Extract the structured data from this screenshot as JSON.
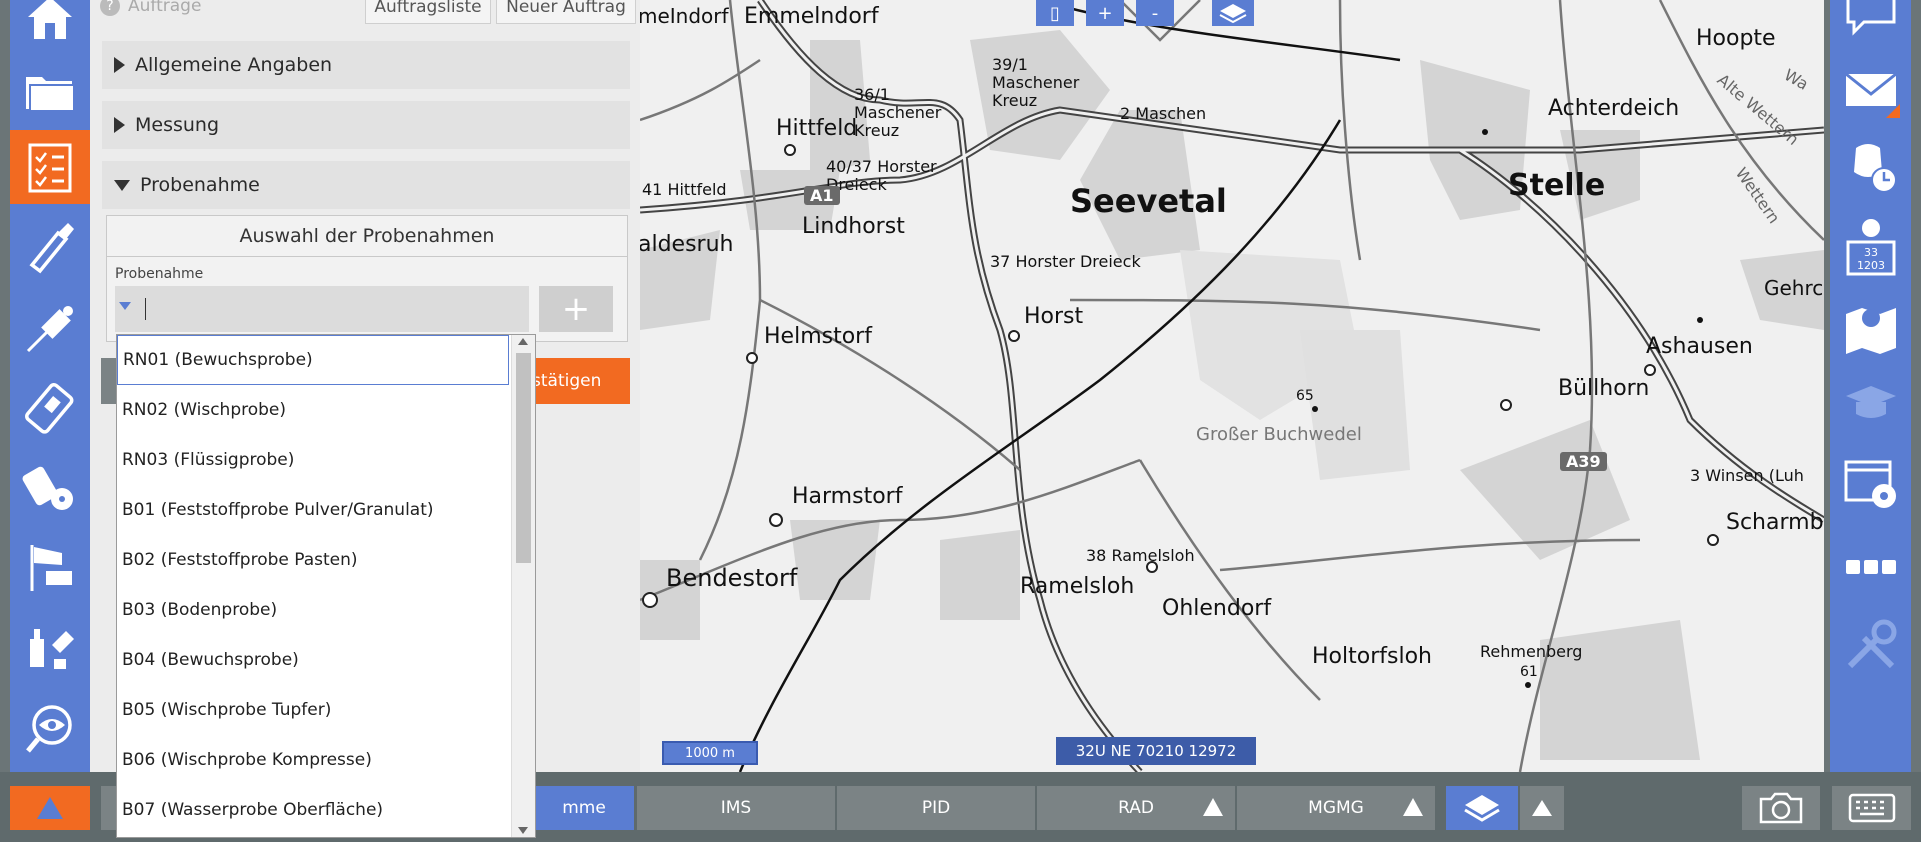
{
  "panel": {
    "top_title": "Aufträge",
    "btn_list": "Auftragsliste",
    "btn_new": "Neuer Auftrag",
    "sections": [
      {
        "label": "Allgemeine Angaben",
        "expanded": false
      },
      {
        "label": "Messung",
        "expanded": false
      },
      {
        "label": "Probenahme",
        "expanded": true
      }
    ],
    "samples_heading": "Auswahl der Probenahmen",
    "probe_label": "Probenahme",
    "probe_value": "",
    "add_label": "+",
    "confirm_label": "stätigen"
  },
  "dropdown": {
    "items": [
      "RN01 (Bewuchsprobe)",
      "RN02 (Wischprobe)",
      "RN03 (Flüssigprobe)",
      "B01 (Feststoffprobe Pulver/Granulat)",
      "B02 (Feststoffprobe Pasten)",
      "B03 (Bodenprobe)",
      "B04 (Bewuchsprobe)",
      "B05 (Wischprobe Tupfer)",
      "B06 (Wischprobe Kompresse)",
      "B07 (Wasserprobe Oberfläche)"
    ],
    "selected_index": 0
  },
  "map": {
    "controls": [
      "▯",
      "+",
      "-"
    ],
    "places": [
      {
        "name": "Emmelndorf",
        "size": 22
      },
      {
        "name": "meIndorf",
        "size": 20
      },
      {
        "name": "Hittfeld",
        "size": 22
      },
      {
        "name": "Seevetal",
        "size": 32
      },
      {
        "name": "Stelle",
        "size": 30
      },
      {
        "name": "Hoopte",
        "size": 22
      },
      {
        "name": "Achterdeich",
        "size": 22
      },
      {
        "name": "Lindhorst",
        "size": 22
      },
      {
        "name": "aldesruh",
        "size": 22
      },
      {
        "name": "Horst",
        "size": 22
      },
      {
        "name": "Helmstorf",
        "size": 22
      },
      {
        "name": "Ashausen",
        "size": 22
      },
      {
        "name": "Büllhorn",
        "size": 22
      },
      {
        "name": "Großer Buchwedel",
        "size": 18
      },
      {
        "name": "Harmstorf",
        "size": 22
      },
      {
        "name": "Bendestorf",
        "size": 24
      },
      {
        "name": "Ramelsloh",
        "size": 22
      },
      {
        "name": "Ohlendorf",
        "size": 22
      },
      {
        "name": "Holtorfsloh",
        "size": 22
      },
      {
        "name": "Rehmenberg",
        "size": 16
      },
      {
        "name": "Scharmb",
        "size": 22
      },
      {
        "name": "Gehrc",
        "size": 20
      },
      {
        "name": "39/1 Maschener Kreuz",
        "size": 16
      },
      {
        "name": "36/1 Maschener Kreuz",
        "size": 16
      },
      {
        "name": "2 Maschen",
        "size": 16
      },
      {
        "name": "40/37 Horster Dreieck",
        "size": 16
      },
      {
        "name": "41 Hittfeld",
        "size": 16
      },
      {
        "name": "37 Horster Dreieck",
        "size": 16
      },
      {
        "name": "38 Ramelsloh",
        "size": 16
      },
      {
        "name": "3 Winsen (Luh",
        "size": 16
      },
      {
        "name": "65",
        "size": 14
      },
      {
        "name": "61",
        "size": 14
      },
      {
        "name": "Alte Wettern",
        "size": 16
      },
      {
        "name": "Wettern",
        "size": 16
      },
      {
        "name": "Wa",
        "size": 16
      }
    ],
    "shields": [
      "A1",
      "A39"
    ],
    "scale_label": "1000 m",
    "coordinate": "32U NE 70210 12972"
  },
  "bottom_tabs": [
    "mme",
    "IMS",
    "PID",
    "RAD",
    "MGMG"
  ],
  "colors": {
    "sidebar_blue": "#5a7dd2",
    "accent_orange": "#f26a21",
    "bottom_bar_gray": "#5f6a6c",
    "tab_gray": "#7b8385"
  },
  "icons": {
    "left": [
      "home-icon",
      "folder-icon",
      "checklist-icon",
      "probe-icon",
      "sensor-probe-icon",
      "dosimeter-icon",
      "radiation-meter-icon",
      "wind-sock-icon",
      "sampling-icon",
      "eye-search-icon"
    ],
    "right": [
      "chat-icon",
      "mail-icon",
      "gas-mask-clock-icon",
      "info-database-icon",
      "map-pin-icon",
      "graduation-cap-icon",
      "settings-window-icon",
      "more-icon",
      "tools-icon"
    ]
  }
}
